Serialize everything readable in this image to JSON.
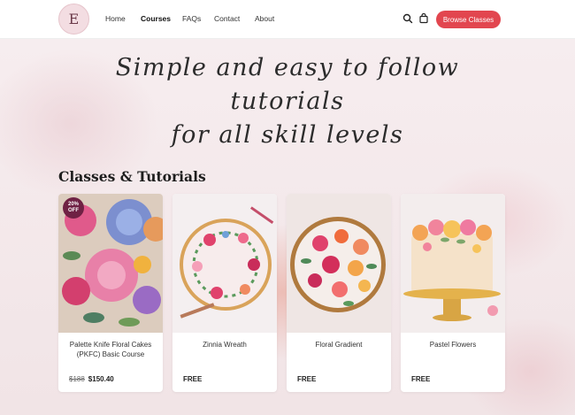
{
  "header": {
    "logo_letter": "E",
    "nav": [
      {
        "label": "Home",
        "active": false
      },
      {
        "label": "Courses",
        "active": true
      },
      {
        "label": "FAQs",
        "active": false
      },
      {
        "label": "Contact",
        "active": false
      },
      {
        "label": "About",
        "active": false
      }
    ],
    "icons": [
      "search-icon",
      "cart-icon"
    ],
    "browse_button": "Browse Classes",
    "accent_color": "#e2464f"
  },
  "hero": {
    "line1": "Simple and easy to follow tutorials",
    "line2": "for all skill levels"
  },
  "section": {
    "title": "Classes & Tutorials"
  },
  "cards": [
    {
      "title": "Palette Knife Floral Cakes (PKFC) Basic Course",
      "badge_top": "20%",
      "badge_bottom": "OFF",
      "old_price": "$188",
      "price": "$150.40"
    },
    {
      "title": "Zinnia Wreath",
      "price": "FREE"
    },
    {
      "title": "Floral Gradient",
      "price": "FREE"
    },
    {
      "title": "Pastel Flowers",
      "price": "FREE"
    }
  ]
}
